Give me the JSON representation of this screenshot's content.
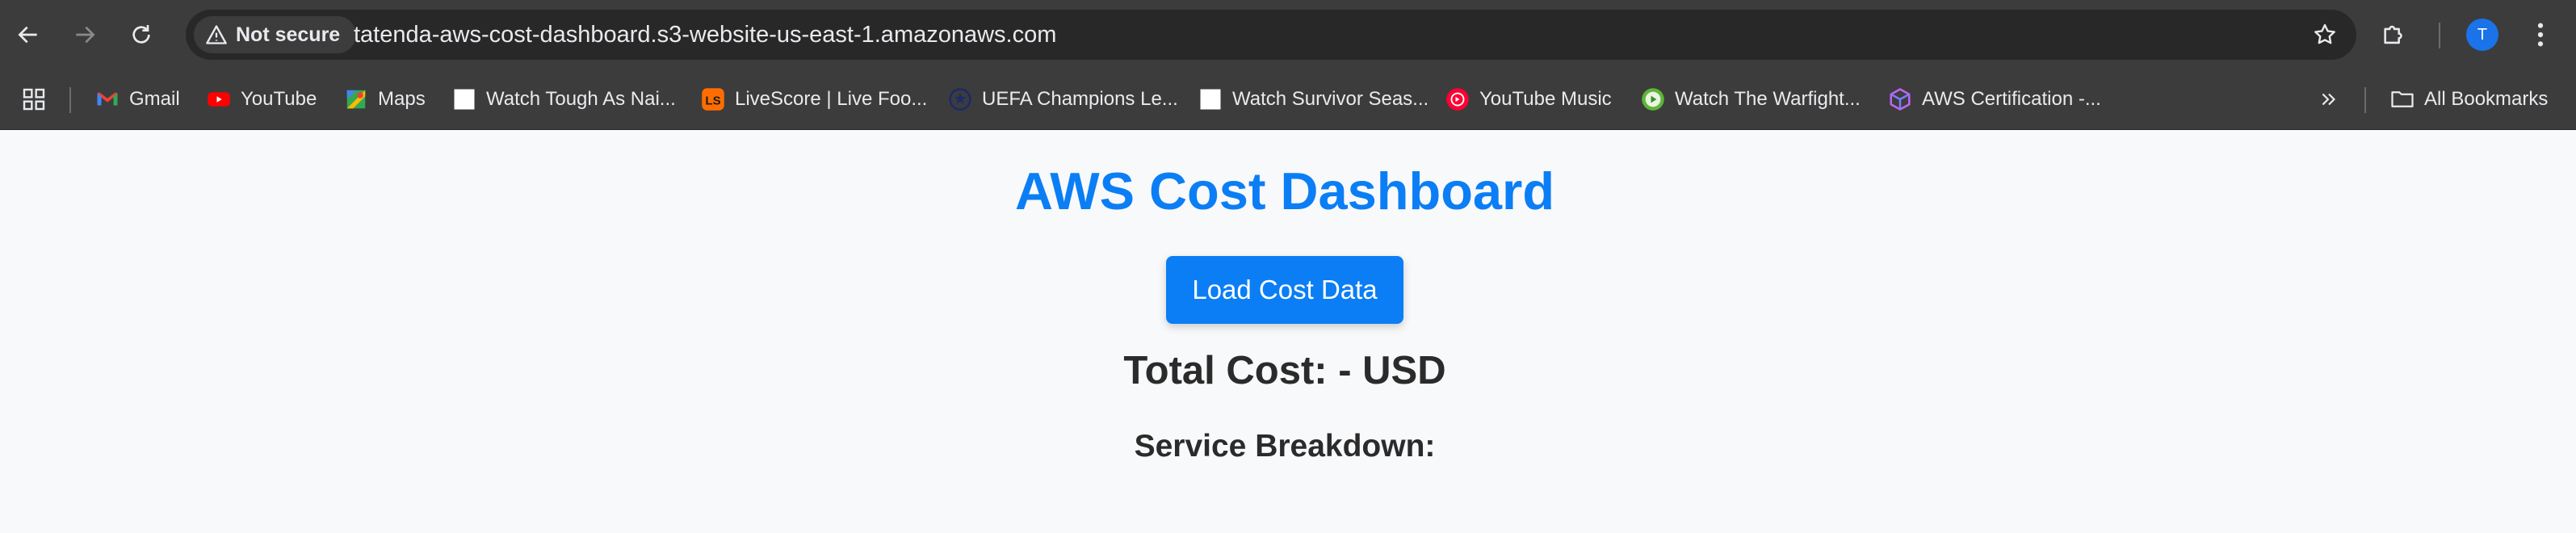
{
  "browser": {
    "security_label": "Not secure",
    "url": "tatenda-aws-cost-dashboard.s3-website-us-east-1.amazonaws.com",
    "profile_initial": "T",
    "icons": [
      "back-arrow-icon",
      "forward-arrow-icon",
      "reload-icon",
      "warning-icon",
      "star-icon",
      "extensions-icon",
      "menu-icon"
    ]
  },
  "bookmarks": {
    "items": [
      {
        "label": "Gmail",
        "icon": "gmail-icon"
      },
      {
        "label": "YouTube",
        "icon": "youtube-icon"
      },
      {
        "label": "Maps",
        "icon": "maps-icon"
      },
      {
        "label": "Watch Tough As Nai...",
        "icon": "blank-page-icon"
      },
      {
        "label": "LiveScore | Live Foo...",
        "icon": "livescore-icon"
      },
      {
        "label": "UEFA Champions Le...",
        "icon": "uefa-icon"
      },
      {
        "label": "Watch Survivor Seas...",
        "icon": "blank-page-icon"
      },
      {
        "label": "YouTube Music",
        "icon": "youtube-music-icon"
      },
      {
        "label": "Watch The Warfight...",
        "icon": "play-circle-icon"
      },
      {
        "label": "AWS Certification -...",
        "icon": "cube-icon"
      }
    ],
    "all_bookmarks_label": "All Bookmarks"
  },
  "page": {
    "title": "AWS Cost Dashboard",
    "load_button_label": "Load Cost Data",
    "total_cost_label": "Total Cost: - USD",
    "breakdown_heading": "Service Breakdown:"
  },
  "colors": {
    "accent": "#0b7ef5",
    "chrome_bg": "#3c3c3c",
    "page_bg": "#f8f9fa",
    "text": "#2b2b2b"
  }
}
